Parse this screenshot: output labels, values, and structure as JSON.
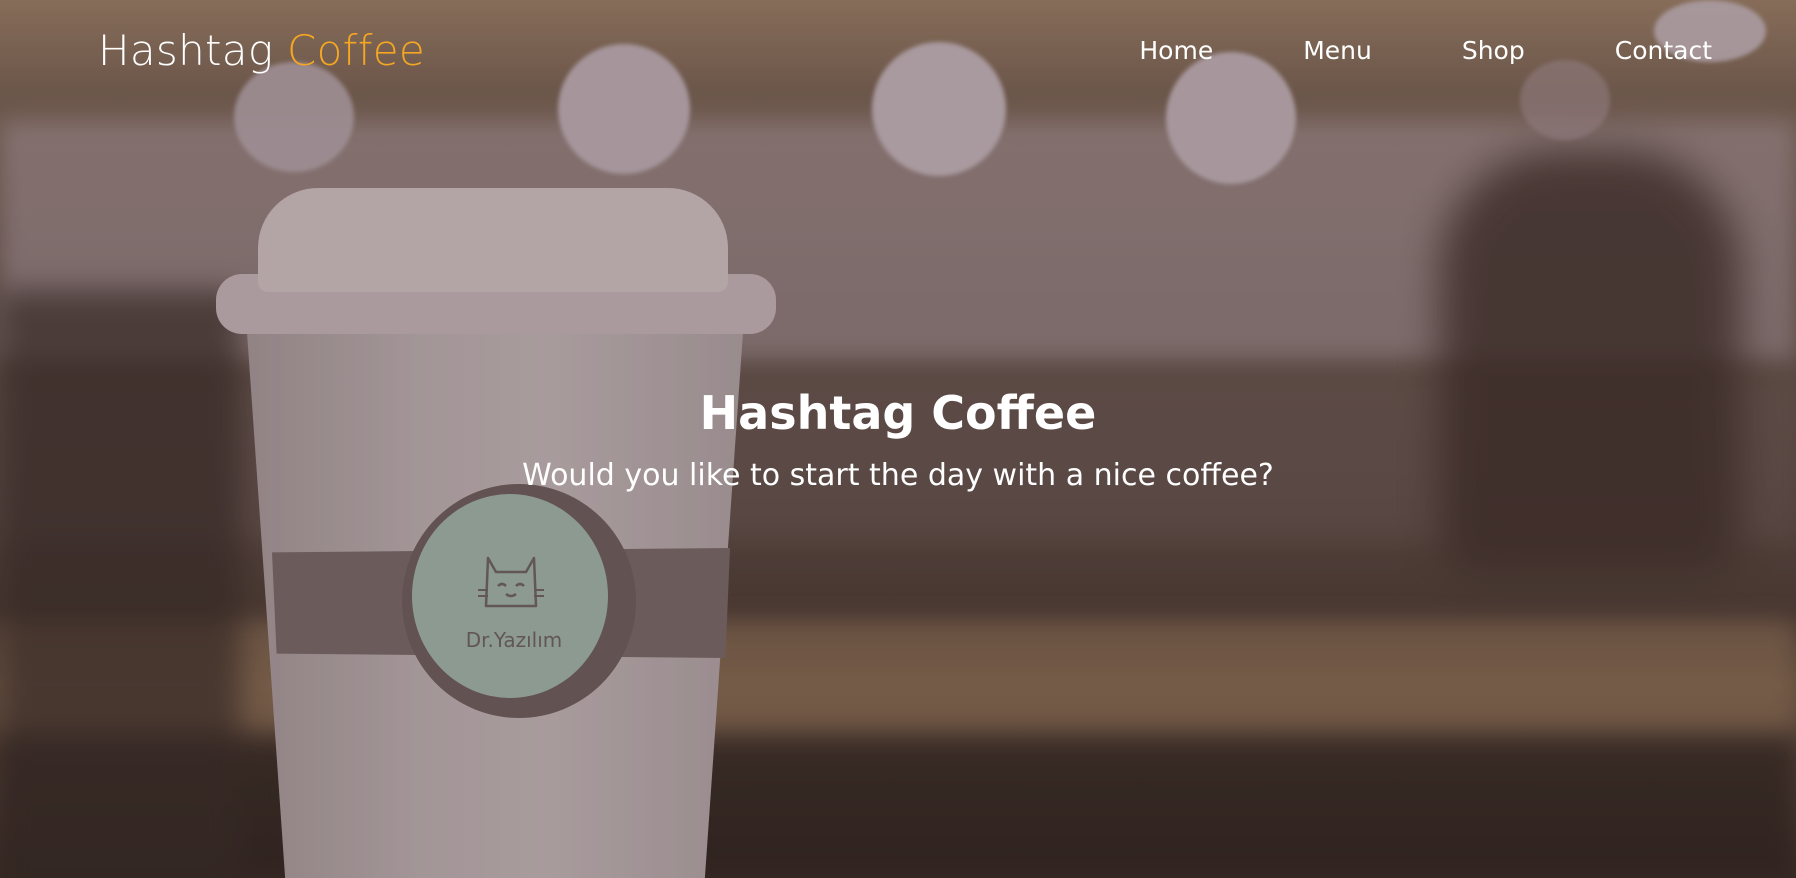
{
  "brand": {
    "name_part1": "Hashtag",
    "name_part2": "Coffee",
    "accent_color": "#f5a623"
  },
  "nav": {
    "items": [
      {
        "label": "Home"
      },
      {
        "label": "Menu"
      },
      {
        "label": "Shop"
      },
      {
        "label": "Contact"
      }
    ]
  },
  "hero": {
    "title": "Hashtag Coffee",
    "subtitle": "Would you like to start the day with a nice coffee?",
    "background": "blurred coffee shop photo with a takeaway cup",
    "cup_seal_text": "Dr.Yazılım",
    "cup_logo_icon": "cat-face-icon"
  }
}
